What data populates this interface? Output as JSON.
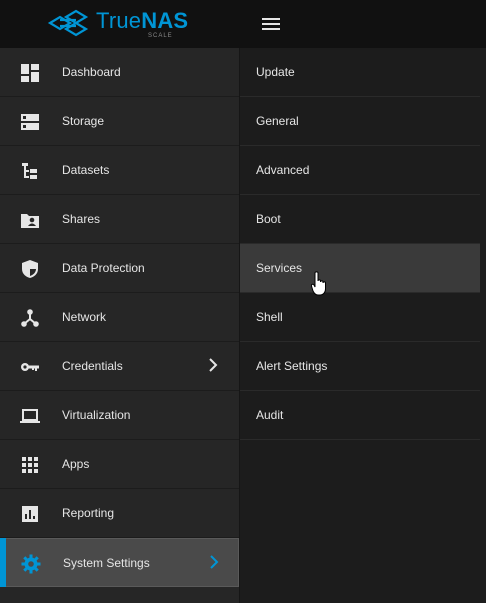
{
  "brand": {
    "name": "TrueNAS",
    "sub": "SCALE",
    "color": "#0095d5"
  },
  "topbar": {
    "menu_icon": "hamburger-icon"
  },
  "accent": "#0095d5",
  "sidebar": {
    "items": [
      {
        "label": "Dashboard",
        "icon": "dashboard-icon"
      },
      {
        "label": "Storage",
        "icon": "storage-icon"
      },
      {
        "label": "Datasets",
        "icon": "datasets-icon"
      },
      {
        "label": "Shares",
        "icon": "shares-icon"
      },
      {
        "label": "Data Protection",
        "icon": "shield-icon"
      },
      {
        "label": "Network",
        "icon": "network-icon"
      },
      {
        "label": "Credentials",
        "icon": "key-icon",
        "has_submenu": true
      },
      {
        "label": "Virtualization",
        "icon": "laptop-icon"
      },
      {
        "label": "Apps",
        "icon": "apps-grid-icon"
      },
      {
        "label": "Reporting",
        "icon": "reporting-icon"
      },
      {
        "label": "System Settings",
        "icon": "gear-icon",
        "has_submenu": true,
        "active": true
      }
    ]
  },
  "submenu": {
    "items": [
      {
        "label": "Update"
      },
      {
        "label": "General"
      },
      {
        "label": "Advanced"
      },
      {
        "label": "Boot"
      },
      {
        "label": "Services",
        "hovered": true
      },
      {
        "label": "Shell"
      },
      {
        "label": "Alert Settings"
      },
      {
        "label": "Audit"
      }
    ]
  }
}
